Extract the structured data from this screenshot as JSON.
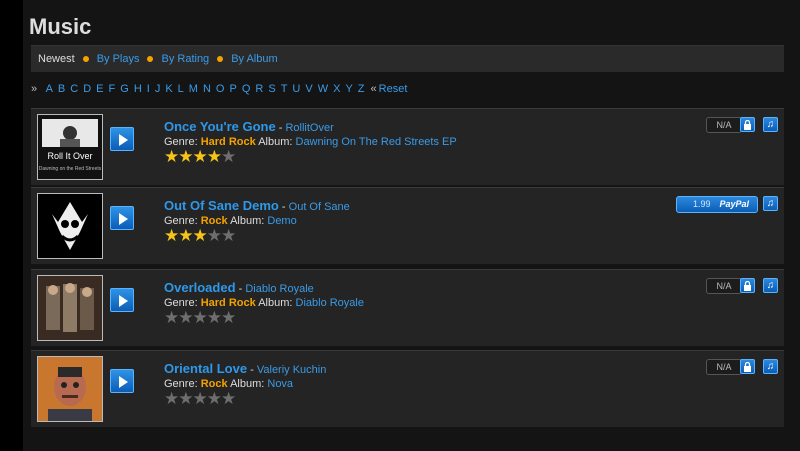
{
  "page": {
    "title": "Music"
  },
  "filters": {
    "current": "Newest",
    "links": [
      "By Plays",
      "By Rating",
      "By Album"
    ]
  },
  "alpha": {
    "letters": [
      "A",
      "B",
      "C",
      "D",
      "E",
      "F",
      "G",
      "H",
      "I",
      "J",
      "K",
      "L",
      "M",
      "N",
      "O",
      "P",
      "Q",
      "R",
      "S",
      "T",
      "U",
      "V",
      "W",
      "X",
      "Y",
      "Z"
    ],
    "open": "»",
    "reset_prefix": "«",
    "reset": "Reset"
  },
  "labels": {
    "genre": "Genre:",
    "album": "Album:",
    "dash": " - "
  },
  "tracks": [
    {
      "title": "Once You're Gone",
      "artist": "RollitOver",
      "genre": "Hard Rock",
      "album": "Dawning On The Red Streets EP",
      "rating": 4,
      "price_label": "N/A",
      "thumb_text": "Roll It Over",
      "thumb_sub": "Dawning on the Red Streets"
    },
    {
      "title": "Out Of Sane Demo",
      "artist": "Out Of Sane",
      "genre": "Rock",
      "album": "Demo",
      "rating": 3,
      "price": "1.99",
      "paypal": "PayPal"
    },
    {
      "title": "Overloaded",
      "artist": "Diablo Royale",
      "genre": "Hard Rock",
      "album": "Diablo Royale",
      "rating": 0,
      "price_label": "N/A"
    },
    {
      "title": "Oriental Love",
      "artist": "Valeriy Kuchin",
      "genre": "Rock",
      "album": "Nova",
      "rating": 0,
      "price_label": "N/A"
    }
  ],
  "icons": {
    "play": "play-icon",
    "lock": "lock-icon",
    "note": "music-note-icon",
    "star": "star-icon"
  },
  "colors": {
    "accent": "#3a9be8",
    "genre": "#f3a200",
    "star": "#f6c416"
  }
}
